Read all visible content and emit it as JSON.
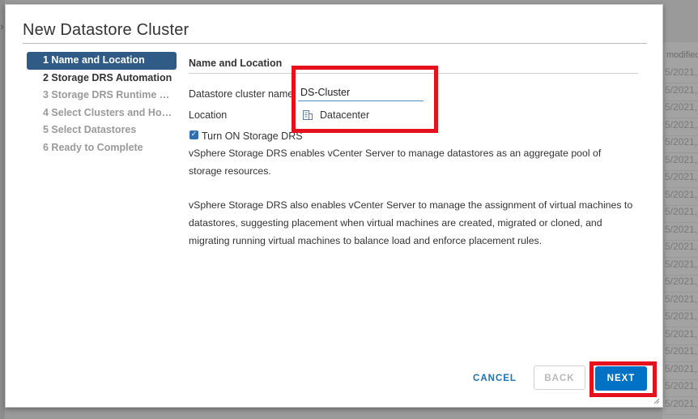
{
  "background": {
    "column_header": "modified",
    "cells": [
      "5/2021,",
      "5/2021,",
      "5/2021,",
      "5/2021,",
      "5/2021,",
      "5/2021,",
      "5/2021,",
      "5/2021,",
      "5/2021,",
      "5/2021,",
      "5/2021,",
      "5/2021,",
      "5/2021,",
      "5/2021,",
      "5/2021,",
      "5/2021,",
      "5/2021,",
      "5/2021,",
      "5/2021,",
      "5/2021,"
    ]
  },
  "dialog": {
    "title": "New Datastore Cluster",
    "steps": [
      {
        "label": "1 Name and Location",
        "state": "active"
      },
      {
        "label": "2 Storage DRS Automation",
        "state": "enabled"
      },
      {
        "label": "3 Storage DRS Runtime Se...",
        "state": "disabled"
      },
      {
        "label": "4 Select Clusters and Hosts",
        "state": "disabled"
      },
      {
        "label": "5 Select Datastores",
        "state": "disabled"
      },
      {
        "label": "6 Ready to Complete",
        "state": "disabled"
      }
    ],
    "section_title": "Name and Location",
    "fields": {
      "name_label": "Datastore cluster name",
      "name_value": "DS-Cluster",
      "location_label": "Location",
      "location_value": "Datacenter"
    },
    "storage_drs": {
      "checked": true,
      "label": "Turn ON Storage DRS"
    },
    "paragraphs": [
      "vSphere Storage DRS enables vCenter Server to manage datastores as an aggregate pool of storage resources.",
      "vSphere Storage DRS also enables vCenter Server to manage the assignment of virtual machines to datastores, suggesting placement when virtual machines are created, migrated or cloned, and migrating running virtual machines to balance load and enforce placement rules."
    ],
    "buttons": {
      "cancel": "CANCEL",
      "back": "BACK",
      "next": "NEXT"
    }
  },
  "colors": {
    "active_step": "#305b86",
    "primary": "#0072c6",
    "highlight": "#e5111c",
    "check": "#3d9a2e"
  }
}
